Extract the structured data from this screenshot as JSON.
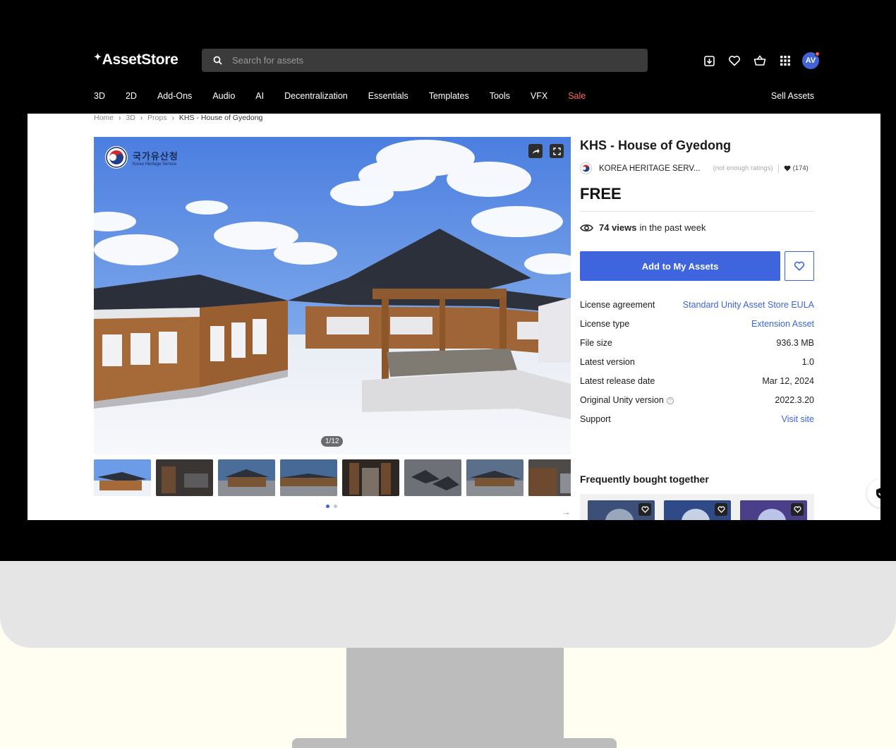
{
  "header": {
    "logo": "AssetStore",
    "search_placeholder": "Search for assets",
    "avatar_initials": "AV",
    "categories": [
      "3D",
      "2D",
      "Add-Ons",
      "Audio",
      "AI",
      "Decentralization",
      "Essentials",
      "Templates",
      "Tools",
      "VFX",
      "Sale"
    ],
    "sell_label": "Sell Assets",
    "icons": [
      "download-box-icon",
      "heart-icon",
      "cart-icon",
      "apps-grid-icon"
    ]
  },
  "breadcrumb": [
    "Home",
    "3D",
    "Props",
    "KHS - House of Gyedong"
  ],
  "gallery": {
    "counter": "1/12",
    "watermark_korean": "국가유산청",
    "watermark_english": "Korea Heritage Service",
    "page_dots": 2,
    "active_dot": 0
  },
  "product": {
    "title": "KHS - House of Gyedong",
    "publisher": "KOREA HERITAGE SERV...",
    "ratings": "(not enough ratings)",
    "likes": "(174)",
    "price": "FREE",
    "views_count": "74 views",
    "views_suffix": "in the past week",
    "add_button": "Add to My Assets"
  },
  "specs": [
    {
      "label": "License agreement",
      "value": "Standard Unity Asset Store EULA",
      "link": true
    },
    {
      "label": "License type",
      "value": "Extension Asset",
      "link": true
    },
    {
      "label": "File size",
      "value": "936.3 MB",
      "link": false
    },
    {
      "label": "Latest version",
      "value": "1.0",
      "link": false
    },
    {
      "label": "Latest release date",
      "value": "Mar 12, 2024",
      "link": false
    },
    {
      "label": "Original Unity version",
      "value": "2022.3.20",
      "link": false,
      "help": "?"
    },
    {
      "label": "Support",
      "value": "Visit site",
      "link": true
    }
  ],
  "frequently_bought": {
    "heading": "Frequently bought together"
  },
  "colors": {
    "accent": "#3e64de",
    "sale": "#ff6a5a",
    "header_bg": "#000000"
  }
}
